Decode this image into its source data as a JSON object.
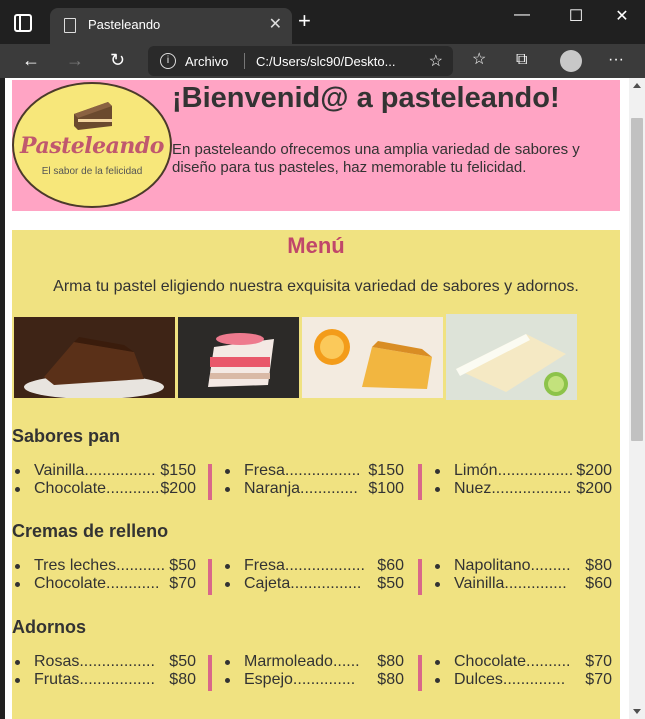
{
  "browser": {
    "tab_title": "Pasteleando",
    "new_tab": "+",
    "address_label": "Archivo",
    "address_url": "C:/Users/slc90/Deskto...",
    "controls": {
      "minimize": "—",
      "maximize": "☐",
      "close": "✕",
      "back": "←",
      "forward": "→",
      "reload": "↻",
      "menu": "···"
    }
  },
  "header": {
    "logo_name": "Pasteleando",
    "logo_tagline": "El sabor de la felicidad",
    "title": "¡Bienvenid@ a pasteleando!",
    "text": "En pasteleando ofrecemos una amplia variedad de sabores y diseño para tus pasteles, haz memorable tu felicidad."
  },
  "menu": {
    "title": "Menú",
    "subtitle": "Arma tu pastel eligiendo nuestra exquisita variedad de sabores y adornos.",
    "sections": [
      {
        "title": "Sabores pan",
        "columns": [
          [
            {
              "name": "Vainilla",
              "dots": "................",
              "price": "$150"
            },
            {
              "name": "Chocolate",
              "dots": "............",
              "price": "$200"
            }
          ],
          [
            {
              "name": "Fresa",
              "dots": ".................",
              "price": "$150"
            },
            {
              "name": "Naranja",
              "dots": ".............",
              "price": "$100"
            }
          ],
          [
            {
              "name": "Limón",
              "dots": ".................",
              "price": "$200"
            },
            {
              "name": "Nuez",
              "dots": "..................",
              "price": "$200"
            }
          ]
        ]
      },
      {
        "title": "Cremas de relleno",
        "columns": [
          [
            {
              "name": "Tres leches",
              "dots": "...........",
              "price": "$50"
            },
            {
              "name": "Chocolate",
              "dots": "............",
              "price": "$70"
            }
          ],
          [
            {
              "name": "Fresa",
              "dots": "..................",
              "price": "$60"
            },
            {
              "name": "Cajeta",
              "dots": "................",
              "price": "$50"
            }
          ],
          [
            {
              "name": "Napolitano",
              "dots": ".........",
              "price": "$80"
            },
            {
              "name": "Vainilla",
              "dots": "..............",
              "price": "$60"
            }
          ]
        ]
      },
      {
        "title": "Adornos",
        "columns": [
          [
            {
              "name": "Rosas",
              "dots": ".................",
              "price": "$50"
            },
            {
              "name": "Frutas",
              "dots": ".................",
              "price": "$80"
            }
          ],
          [
            {
              "name": "Marmoleado",
              "dots": "......",
              "price": "$80"
            },
            {
              "name": "Espejo",
              "dots": "..............",
              "price": "$80"
            }
          ],
          [
            {
              "name": "Chocolate",
              "dots": "..........",
              "price": "$70"
            },
            {
              "name": "Dulces",
              "dots": "..............",
              "price": "$70"
            }
          ]
        ]
      }
    ]
  },
  "colors": {
    "header_bg": "#ffa4c4",
    "menu_bg": "#f0e281",
    "accent": "#c0476a",
    "divider": "#d9678a"
  }
}
